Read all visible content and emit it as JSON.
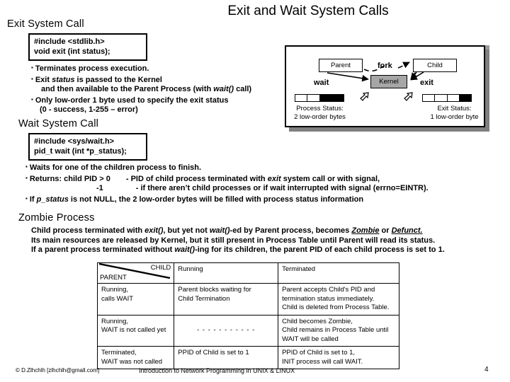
{
  "slide": {
    "title": "Exit and Wait System Calls",
    "page_number": "4"
  },
  "exit_section": {
    "heading": "Exit System Call",
    "code_line1": "#include <stdlib.h>",
    "code_line2": "void exit (int status);",
    "bullets": {
      "b1": "Terminates process execution.",
      "b2_a": "Exit ",
      "b2_i": "status",
      "b2_b": " is passed to the Kernel",
      "b2_cont_a": "and then available to the Parent Process  (with ",
      "b2_cont_i": "wait()",
      "b2_cont_b": " call)",
      "b3": "Only low-order 1 byte used to specify the exit status",
      "b3_cont": "(0 - success, 1-255 – error)"
    }
  },
  "wait_section": {
    "heading": "Wait System Call",
    "code_line1": "#include <sys/wait.h>",
    "code_line2": "pid_t wait (int *p_status);",
    "bullets": {
      "b1": "Waits for one of the children process to finish.",
      "b2_a": "Returns: child PID > 0",
      "b2_b_pre": "- PID of child process terminated with ",
      "b2_b_i": "exit",
      "b2_b_post": " system call or with signal,",
      "b2_cont_a": "-1",
      "b2_cont_b": "- if there aren’t child processes or if wait interrupted with signal (errno=EINTR).",
      "b3_pre": "If ",
      "b3_i": "p_status",
      "b3_post": " is not NULL, the 2 low-order bytes will be filled with process status information"
    }
  },
  "zombie_section": {
    "heading": "Zombie Process",
    "line1_a": "Child process terminated with ",
    "line1_i1": "exit()",
    "line1_b": ", but yet not ",
    "line1_i2": "wait()",
    "line1_c": "-ed by Parent process, becomes ",
    "line1_u1": "Zombie",
    "line1_d": " or ",
    "line1_u2": "Defunct.",
    "line2": "Its main resources are released by Kernel, but it still present in Process Table until Parent will read its status.",
    "line3_a": "If a parent process terminated without ",
    "line3_i": "wait()",
    "line3_b": "-ing for its children, the parent PID of each child process is set to 1."
  },
  "diagram": {
    "parent": "Parent",
    "child": "Child",
    "kernel": "Kernel",
    "fork_label": "fork",
    "wait_label": "wait",
    "exit_label": "exit",
    "process_status_caption_l1": "Process  Status:",
    "process_status_caption_l2": "2 low-order bytes",
    "exit_status_caption_l1": "Exit Status:",
    "exit_status_caption_l2": "1 low-order byte",
    "kernel_fill": "#a6a6a6",
    "shadow_color": "#808080"
  },
  "state_table": {
    "header": {
      "child_label": "CHILD",
      "parent_label": "PARENT",
      "col_running": "Running",
      "col_terminated": "Terminated"
    },
    "rows": [
      {
        "state_l1": "Running,",
        "state_l2": "calls WAIT",
        "running_l1": "Parent blocks waiting for",
        "running_l2": "Child Termination",
        "terminated_l1": "Parent accepts Child's PID and",
        "terminated_l2": "termination status immediately.",
        "terminated_l3": "Child is deleted from Process Table."
      },
      {
        "state_l1": "Running,",
        "state_l2": "WAIT is not called yet",
        "running_l1": "- - - - - - - - - - -",
        "running_l2": "",
        "terminated_l1": "Child becomes Zombie,",
        "terminated_l2": "Child remains in Process Table until",
        "terminated_l3": "WAIT will be called"
      },
      {
        "state_l1": "Terminated,",
        "state_l2": "WAIT was not called",
        "running_l1": "PPID of Child is set to 1",
        "running_l2": "",
        "terminated_l1": "PPID of  Child is set to 1,",
        "terminated_l2": "INIT process will call WAIT.",
        "terminated_l3": ""
      }
    ]
  },
  "footer": {
    "copyright": "© D.Zlhchlh [zlhchlh@gmall.com]",
    "center": "Introduction to Network Programming in UNIX & LINUX",
    "page": "4"
  }
}
